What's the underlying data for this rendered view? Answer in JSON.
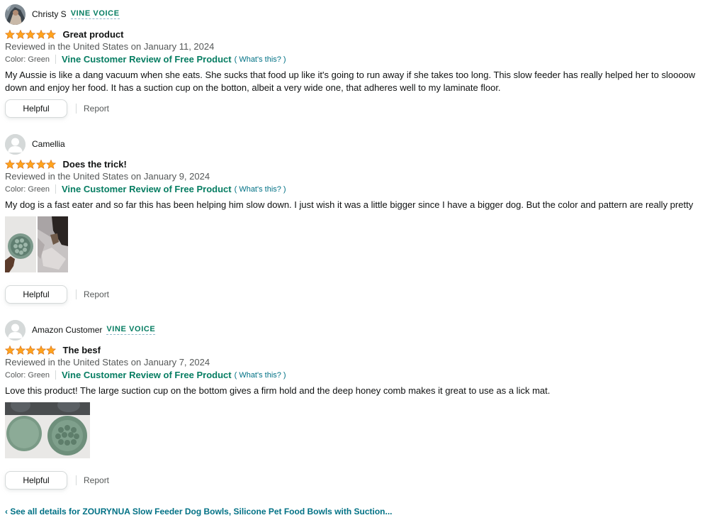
{
  "reviews": [
    {
      "author": "Christy S",
      "badge": "VINE VOICE",
      "rating": 5,
      "title": "Great product",
      "date": "Reviewed in the United States on January 11, 2024",
      "variant": "Color: Green",
      "vine_label": "Vine Customer Review of Free Product",
      "whats_this": "( What's this? )",
      "body": "My Aussie is like a dang vacuum when she eats. She sucks that food up like it's going to run away if she takes too long. This slow feeder has really helped her to sloooow down and enjoy her food. It has a suction cup on the botton, albeit a very wide one, that adheres well to my laminate floor.",
      "helpful_label": "Helpful",
      "report_label": "Report"
    },
    {
      "author": "Camellia",
      "badge": "",
      "rating": 5,
      "title": "Does the trick!",
      "date": "Reviewed in the United States on January 9, 2024",
      "variant": "Color: Green",
      "vine_label": "Vine Customer Review of Free Product",
      "whats_this": "( What's this? )",
      "body": "My dog is a fast eater and so far this has been helping him slow down. I just wish it was a little bigger since I have a bigger dog. But the color and pattern are really pretty",
      "helpful_label": "Helpful",
      "report_label": "Report"
    },
    {
      "author": "Amazon Customer",
      "badge": "VINE VOICE",
      "rating": 5,
      "title": "The besf",
      "date": "Reviewed in the United States on January 7, 2024",
      "variant": "Color: Green",
      "vine_label": "Vine Customer Review of Free Product",
      "whats_this": "( What's this? )",
      "body": "Love this product! The large suction cup on the bottom gives a firm hold and the deep honey comb makes it great to use as a lick mat.",
      "helpful_label": "Helpful",
      "report_label": "Report"
    }
  ],
  "footer_link": "‹ See all details for ZOURYNUA Slow Feeder Dog Bowls, Silicone Pet Food Bowls with Suction...",
  "colors": {
    "star": "#ffa41c",
    "vine_green": "#067d62",
    "link": "#007185",
    "muted": "#565959"
  }
}
